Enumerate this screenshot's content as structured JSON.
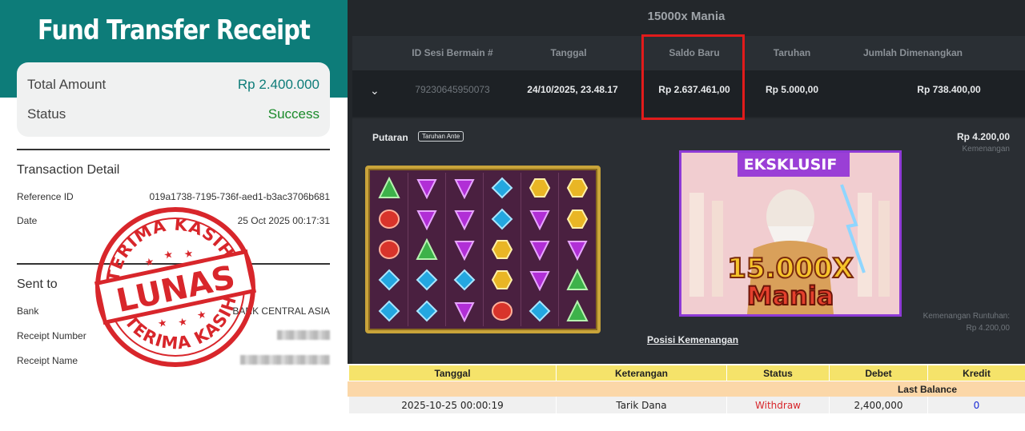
{
  "receipt": {
    "title": "Fund Transfer Receipt",
    "total_amount_label": "Total Amount",
    "total_amount_value": "Rp 2.400.000",
    "status_label": "Status",
    "status_value": "Success",
    "transaction_detail_title": "Transaction Detail",
    "reference_id_label": "Reference ID",
    "reference_id_value": "019a1738-7195-736f-aed1-b3ac3706b681",
    "date_label": "Date",
    "date_value": "25 Oct 2025 00:17:31",
    "sent_to_title": "Sent to",
    "bank_label": "Bank",
    "bank_value": "BANK CENTRAL ASIA",
    "receipt_number_label": "Receipt Number",
    "receipt_name_label": "Receipt Name",
    "colors": {
      "header": "#0d7c79",
      "success": "#1a8a2a"
    }
  },
  "stamp": {
    "top_text": "TERIMA KASIH",
    "center_text": "LUNAS",
    "bottom_text": "TERIMA KASIH",
    "color": "#d8262b"
  },
  "game": {
    "title": "15000x Mania",
    "columns": [
      "ID Sesi Bermain #",
      "Tanggal",
      "Saldo Baru",
      "Taruhan",
      "Jumlah Dimenangkan"
    ],
    "row": {
      "session_id": "79230645950073",
      "date": "24/10/2025, 23.48.17",
      "new_balance": "Rp 2.637.461,00",
      "bet": "Rp 5.000,00",
      "won": "Rp 738.400,00"
    },
    "detail": {
      "spin_label": "Putaran",
      "ante_badge": "Taruhan Ante",
      "win_amount": "Rp 4.200,00",
      "win_label": "Kemenangan",
      "cascade_label": "Kemenangan Runtuhan:",
      "cascade_amount": "Rp 4.200,00",
      "win_position_link": "Posisi Kemenangan"
    },
    "promo": {
      "badge": "EKSKLUSIF",
      "multiplier": "15.000X",
      "name": "Mania"
    },
    "reel_symbols": [
      [
        "green-gem",
        "purple-gem",
        "purple-gem",
        "blue-gem",
        "gold-gem",
        "gold-gem"
      ],
      [
        "red-gem",
        "purple-gem",
        "purple-gem",
        "blue-gem",
        "purple-gem",
        "gold-gem"
      ],
      [
        "red-gem",
        "green-gem",
        "purple-gem",
        "gold-gem",
        "purple-gem",
        "purple-gem"
      ],
      [
        "blue-gem",
        "blue-gem",
        "blue-gem",
        "gold-gem",
        "purple-gem",
        "green-gem"
      ],
      [
        "blue-gem",
        "blue-gem",
        "purple-gem",
        "red-gem",
        "blue-gem",
        "green-gem"
      ]
    ]
  },
  "ledger": {
    "headers": [
      "Tanggal",
      "Keterangan",
      "Status",
      "Debet",
      "Kredit"
    ],
    "last_balance_label": "Last Balance",
    "row": {
      "date": "2025-10-25 00:00:19",
      "description": "Tarik Dana",
      "status": "Withdraw",
      "debit": "2,400,000",
      "credit": "0"
    }
  }
}
